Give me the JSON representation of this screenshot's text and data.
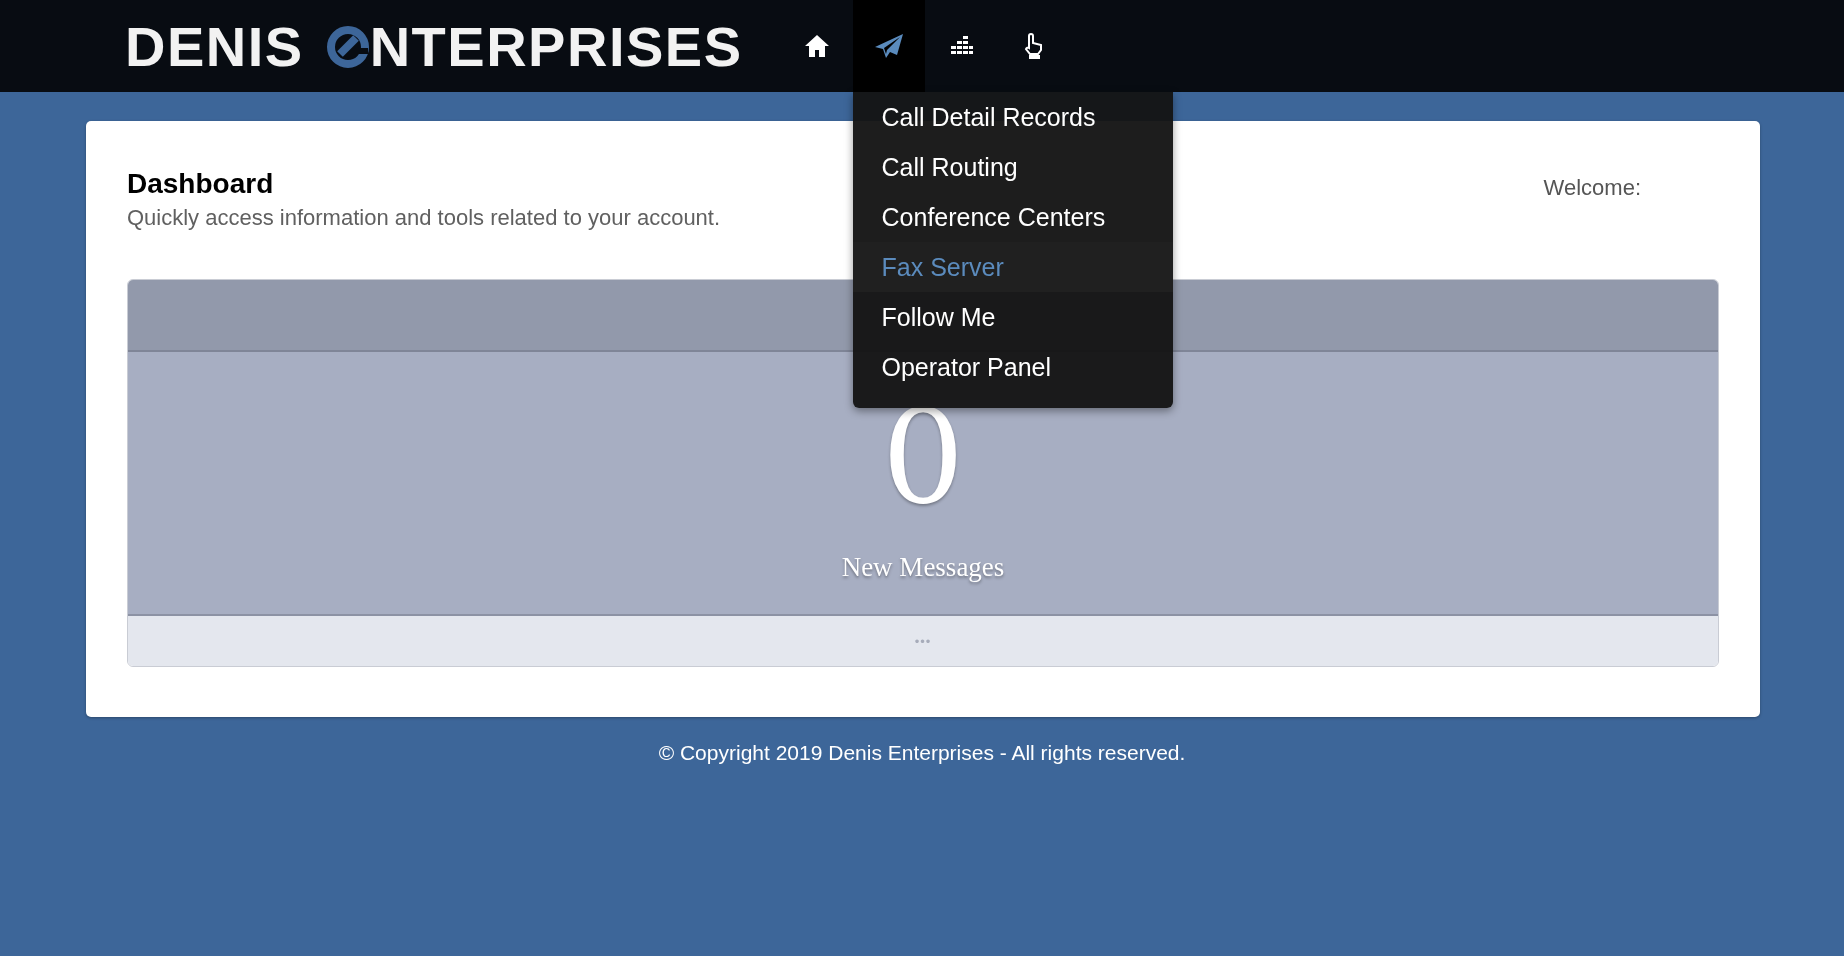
{
  "header": {
    "logo": {
      "part_1": "DENIS",
      "part_2": "NTERPRISES"
    },
    "nav": [
      {
        "kind": "home",
        "selected": false
      },
      {
        "kind": "send",
        "selected": true
      },
      {
        "kind": "chart",
        "selected": false
      },
      {
        "kind": "pointer",
        "selected": false
      }
    ]
  },
  "dropdown": {
    "items": [
      {
        "label": "Call Detail Records",
        "selected": false
      },
      {
        "label": "Call Routing",
        "selected": false
      },
      {
        "label": "Conference Centers",
        "selected": false
      },
      {
        "label": "Fax Server",
        "selected": true
      },
      {
        "label": "Follow Me",
        "selected": false
      },
      {
        "label": "Operator Panel",
        "selected": false
      }
    ]
  },
  "page": {
    "title": "Dashboard",
    "subtitle": "Quickly access information and tools related to your account.",
    "welcome": "Welcome:"
  },
  "widget": {
    "count": "0",
    "label": "New Messages",
    "more": "•••"
  },
  "footer": "© Copyright 2019 Denis Enterprises - All rights reserved."
}
